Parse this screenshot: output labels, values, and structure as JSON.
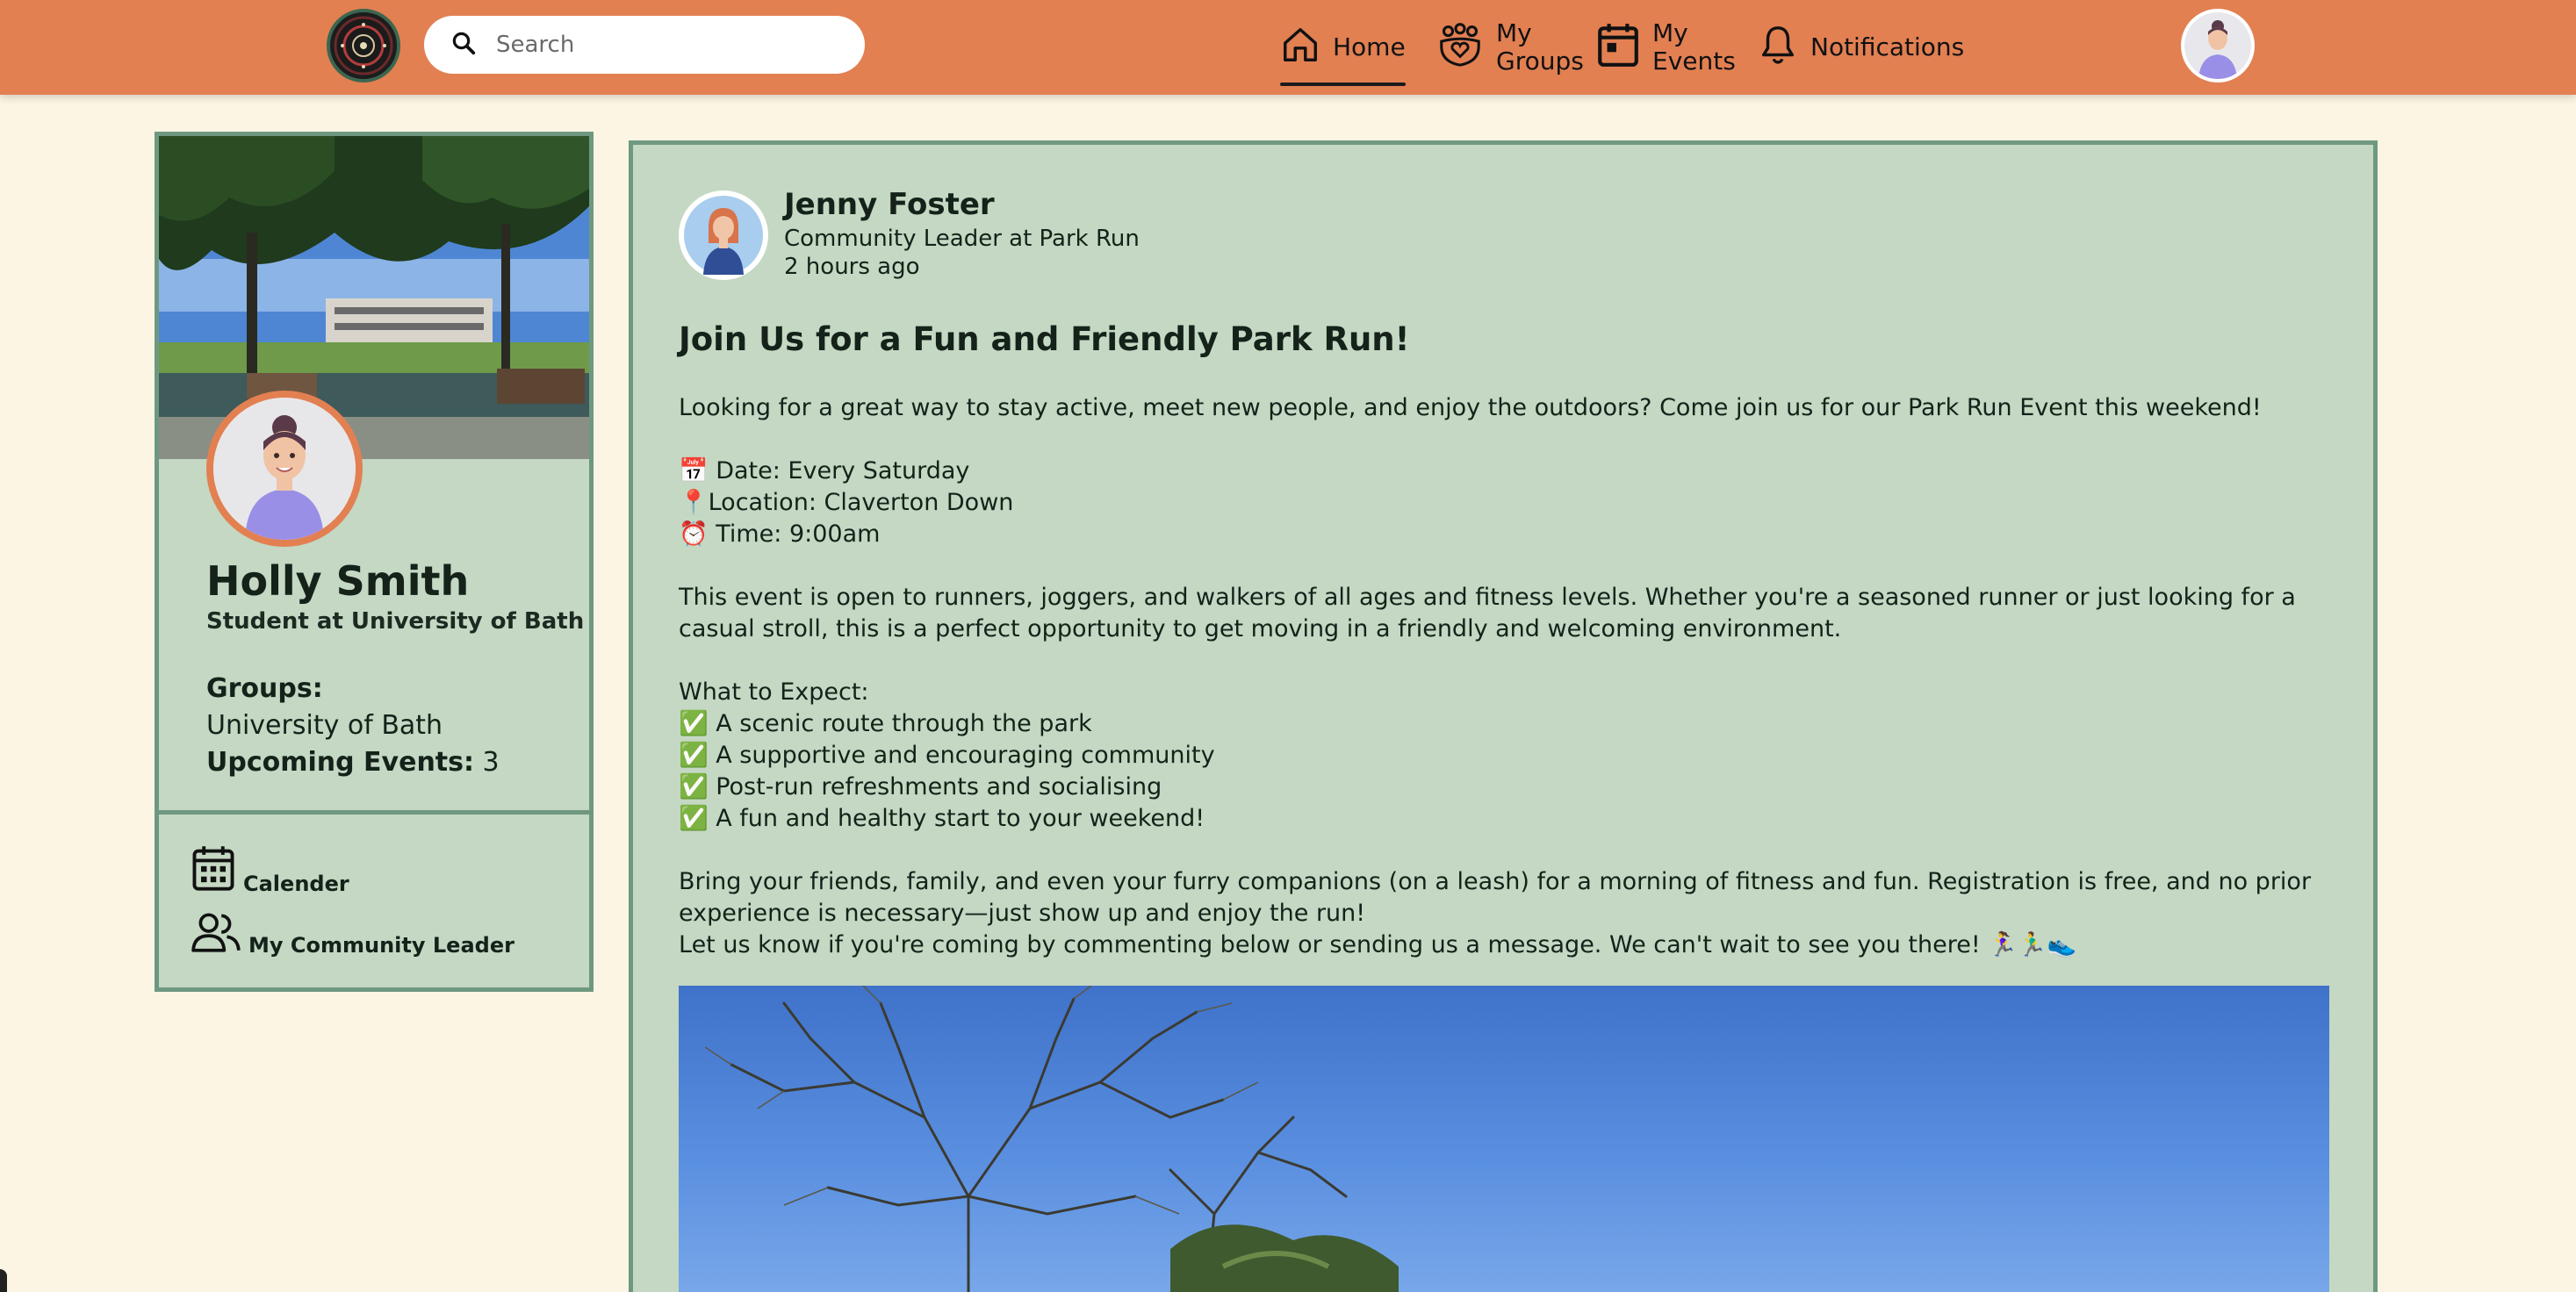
{
  "topbar": {
    "search_placeholder": "Search",
    "nav": {
      "home": "Home",
      "groups_line1": "My",
      "groups_line2": "Groups",
      "events_line1": "My",
      "events_line2": "Events",
      "notifications": "Notifications"
    },
    "active": "home"
  },
  "profile": {
    "name": "Holly Smith",
    "role": "Student at University of Bath",
    "groups_label": "Groups:",
    "groups_value": "University of Bath",
    "events_label": "Upcoming Events:",
    "events_value": "3",
    "links": {
      "calendar": "Calender",
      "leader": "My Community Leader"
    }
  },
  "post": {
    "author": "Jenny Foster",
    "author_role": "Community Leader at Park Run",
    "time": "2 hours ago",
    "title": "Join Us for a Fun and Friendly Park Run!",
    "intro": "Looking for a great way to stay active, meet new people, and enjoy the outdoors? Come join us for our Park Run Event this weekend!",
    "date": "📅 Date: Every Saturday",
    "location": "📍Location: Claverton Down",
    "time_line": "⏰ Time: 9:00am",
    "paragraph1": "This event is open to runners, joggers, and walkers of all ages and fitness levels. Whether you're a seasoned runner or just looking for a casual stroll, this is a perfect opportunity to get moving in a friendly and welcoming environment.",
    "expect_heading": "What to Expect:",
    "expect": [
      "✅ A scenic route through the park",
      "✅ A supportive and encouraging community",
      "✅ Post-run refreshments and socialising",
      "✅ A fun and healthy start to your weekend!"
    ],
    "paragraph2": "Bring your friends, family, and even your furry companions (on a leash) for a morning of fitness and fun. Registration is free, and no prior experience is necessary—just show up and enjoy the run!",
    "paragraph3": "Let us know if you're coming by commenting below or sending us a message. We can't wait to see you there! 🏃‍♀️🏃‍♂️👟"
  },
  "colors": {
    "topbar": "#e28052",
    "background": "#fdf5e3",
    "card": "#c4d8c3",
    "card_border": "#6f9880",
    "avatar_ring": "#e28052"
  },
  "icons": [
    "app-logo-icon",
    "search-icon",
    "home-icon",
    "groups-icon",
    "events-calendar-icon",
    "bell-icon",
    "calendar-icon",
    "people-icon"
  ]
}
